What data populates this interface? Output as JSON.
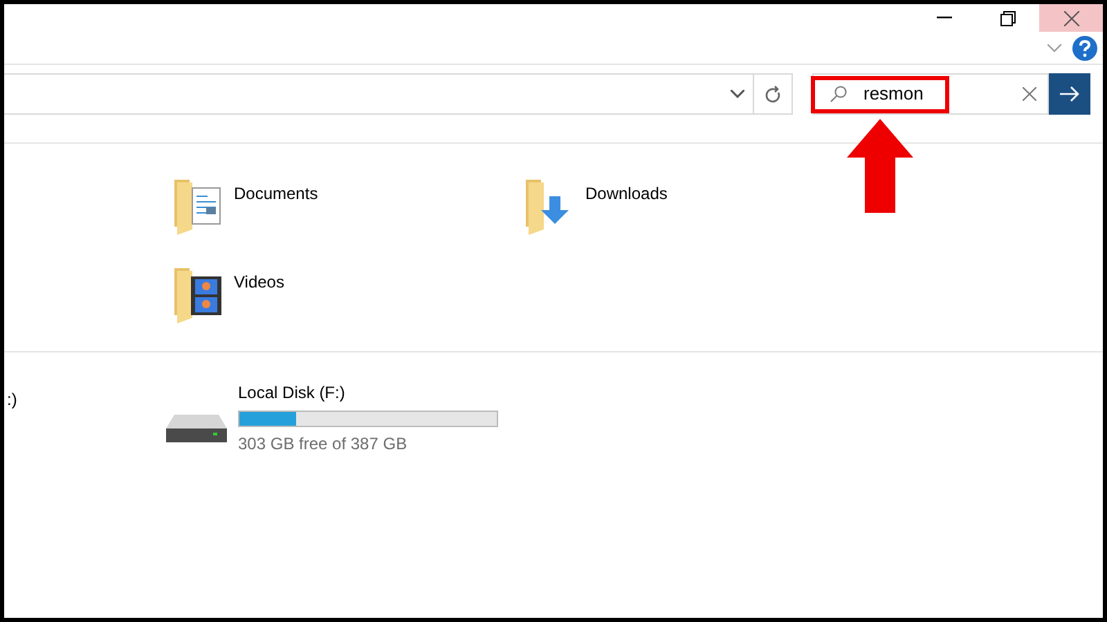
{
  "search": {
    "value": "resmon",
    "highlighted": true
  },
  "folders": [
    {
      "name": "Documents",
      "kind": "documents"
    },
    {
      "name": "Downloads",
      "kind": "downloads"
    },
    {
      "name": "Videos",
      "kind": "videos"
    }
  ],
  "drives": [
    {
      "name": ":)",
      "kind": "cut"
    },
    {
      "name": "Local Disk (F:)",
      "kind": "full",
      "level": 0.22,
      "free": "303 GB free of 387 GB"
    }
  ]
}
